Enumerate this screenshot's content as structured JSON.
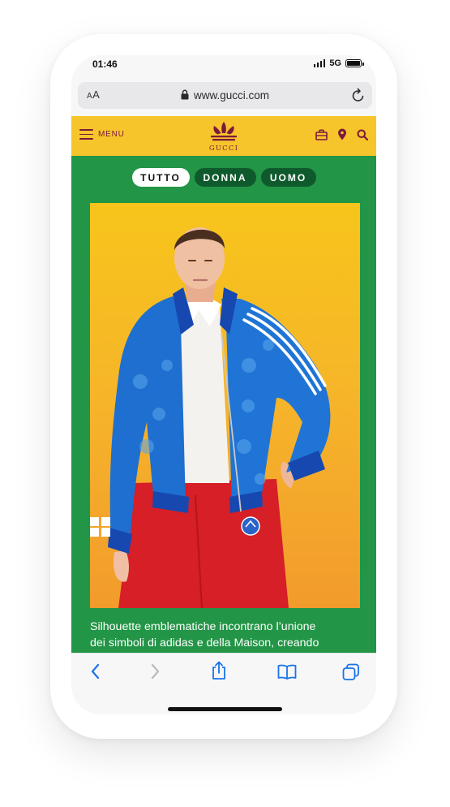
{
  "status_bar": {
    "time": "01:46",
    "network": "5G"
  },
  "browser": {
    "text_size_label": "A",
    "text_size_label_small": "A",
    "url": "www.gucci.com"
  },
  "site_header": {
    "menu_label": "MENU",
    "logo_text": "GUCCI"
  },
  "tabs": [
    {
      "label": "TUTTO",
      "active": true
    },
    {
      "label": "DONNA",
      "active": false
    },
    {
      "label": "UOMO",
      "active": false
    }
  ],
  "caption": {
    "line1": "Silhouette emblematiche incontrano l’unione",
    "line2": "dei simboli di adidas e della Maison, creando"
  },
  "colors": {
    "header_yellow": "#f6c52b",
    "brand_maroon": "#7b1a3c",
    "content_green": "#229546",
    "tab_dark_green": "#0f5a2c",
    "ios_blue": "#1a73e8"
  },
  "icons": [
    "lock-icon",
    "reload-icon",
    "hamburger-icon",
    "bag-icon",
    "location-pin-icon",
    "search-icon",
    "back-icon",
    "forward-icon",
    "share-icon",
    "bookmarks-icon",
    "tabs-icon"
  ]
}
